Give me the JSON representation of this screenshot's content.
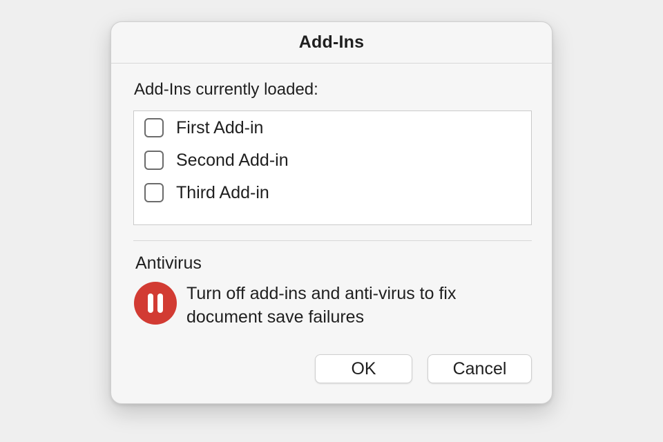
{
  "dialog": {
    "title": "Add-Ins",
    "addins_label": "Add-Ins currently loaded:",
    "addins": [
      {
        "label": "First Add-in",
        "checked": false
      },
      {
        "label": "Second Add-in",
        "checked": false
      },
      {
        "label": "Third Add-in",
        "checked": false
      }
    ],
    "antivirus_heading": "Antivirus",
    "antivirus_icon": "pause-circle-icon",
    "antivirus_icon_color": "#d23b33",
    "antivirus_message": "Turn off add-ins and anti-virus to fix document save failures",
    "buttons": {
      "ok_label": "OK",
      "cancel_label": "Cancel"
    }
  }
}
